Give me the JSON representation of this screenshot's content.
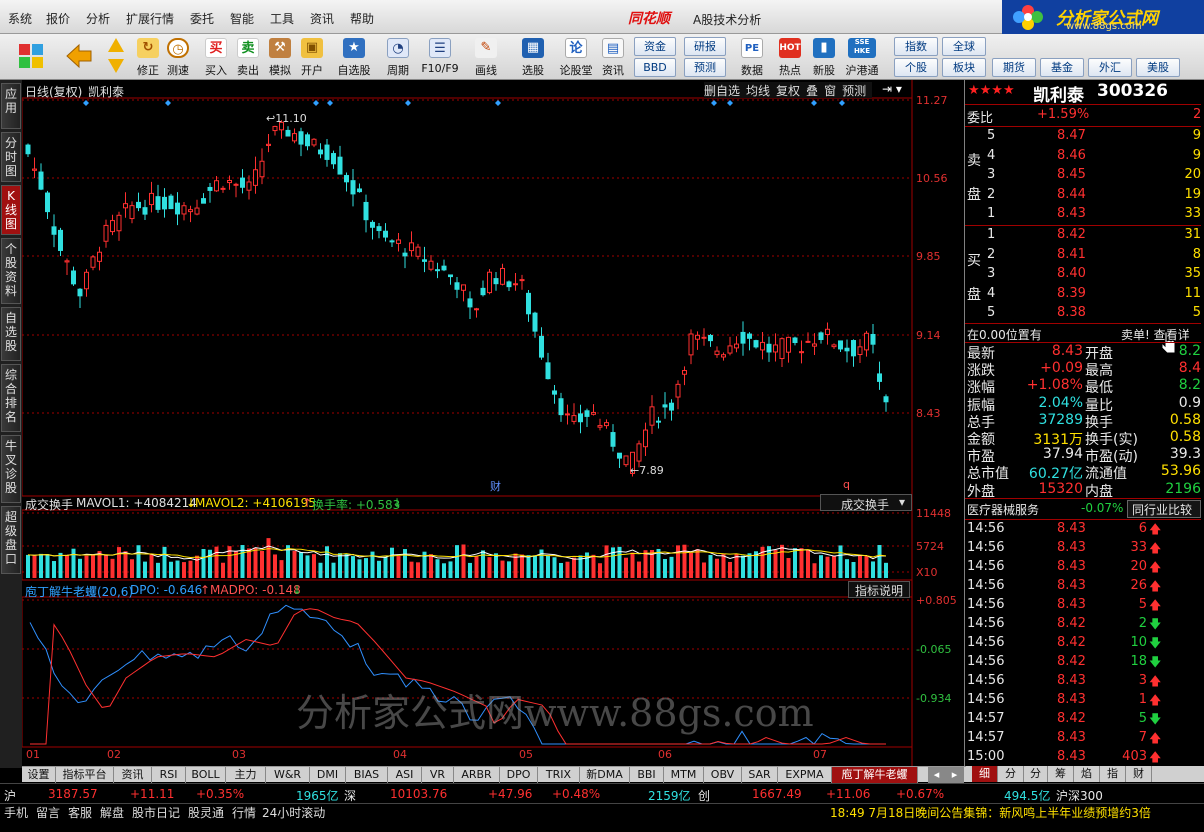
{
  "menu": [
    "系统",
    "报价",
    "分析",
    "扩展行情",
    "委托",
    "智能",
    "工具",
    "资讯",
    "帮助"
  ],
  "app": {
    "logo": "同花顺",
    "title": "A股技术分析"
  },
  "brand": {
    "name": "分析家公式网",
    "url": "www.88gs.com"
  },
  "toolbar": [
    "修正",
    "测速",
    "买入",
    "卖出",
    "模拟",
    "开户",
    "自选股",
    "周期",
    "F10/F9",
    "画线",
    "选股",
    "论股堂",
    "资讯",
    "数据",
    "热点",
    "新股",
    "沪港通"
  ],
  "toolbar_icons": {
    "buy": "买",
    "sell": "卖",
    "data": "PE",
    "hot": "HOT",
    "hk": "SSE HKE",
    "lun": "论"
  },
  "toolbar_btns": [
    "资金",
    "研报",
    "BBD",
    "预测",
    "指数",
    "全球",
    "个股",
    "板块",
    "期货",
    "基金",
    "外汇",
    "美股"
  ],
  "left_tabs": [
    "应用",
    "分时图",
    "K线图",
    "个股资料",
    "自选股",
    "综合排名",
    "牛叉诊股",
    "超级盘口"
  ],
  "main": {
    "title": "日线(复权)",
    "stock": "凯利泰",
    "ctrl": [
      "删自选",
      "均线",
      "复权",
      "叠",
      "窗",
      "预测"
    ],
    "prices": [
      "11.27",
      "10.56",
      "9.85",
      "9.14",
      "8.43"
    ],
    "high_label": "11.10",
    "low_label": "7.89",
    "markers": [
      "财",
      "q"
    ]
  },
  "vol": {
    "name": "成交换手",
    "mavol1": "MAVOL1: +4084214",
    "mavol2": "MAVOL2: +4106195",
    "turnover": "换手率: +0.583",
    "dropdown": "成交换手",
    "axis": [
      "11448",
      "5724",
      "X10"
    ]
  },
  "ind": {
    "name": "庖丁解牛老蠼(20,6)",
    "dpo": "DPO: -0.646",
    "madpo": "MADPO: -0.148",
    "btn": "指标说明",
    "axis": [
      "+0.805",
      "-0.065",
      "-0.934"
    ]
  },
  "watermark": "分析家公式网www.88gs.com",
  "months": [
    "01",
    "02",
    "03",
    "04",
    "05",
    "06",
    "07"
  ],
  "bottom_tabs": [
    "设置",
    "指标平台",
    "资讯",
    "RSI",
    "BOLL",
    "主力",
    "W&R",
    "DMI",
    "BIAS",
    "ASI",
    "VR",
    "ARBR",
    "DPO",
    "TRIX",
    "新DMA",
    "BBI",
    "MTM",
    "OBV",
    "SAR",
    "EXPMA",
    "庖丁解牛老蠼"
  ],
  "right": {
    "stars": "★★★★",
    "name": "凯利泰",
    "code": "300326",
    "weibi_label": "委比",
    "weibi": "+1.59%",
    "weibi_r": "2",
    "sell_label": [
      "卖",
      "盘"
    ],
    "buy_label": [
      "买",
      "盘"
    ],
    "sell": [
      {
        "n": "5",
        "p": "8.47",
        "v": "9"
      },
      {
        "n": "4",
        "p": "8.46",
        "v": "9"
      },
      {
        "n": "3",
        "p": "8.45",
        "v": "20"
      },
      {
        "n": "2",
        "p": "8.44",
        "v": "19"
      },
      {
        "n": "1",
        "p": "8.43",
        "v": "33"
      }
    ],
    "buy": [
      {
        "n": "1",
        "p": "8.42",
        "v": "31"
      },
      {
        "n": "2",
        "p": "8.41",
        "v": "8"
      },
      {
        "n": "3",
        "p": "8.40",
        "v": "35"
      },
      {
        "n": "4",
        "p": "8.39",
        "v": "11"
      },
      {
        "n": "5",
        "p": "8.38",
        "v": "5"
      }
    ],
    "info_left": "在0.00位置有",
    "info_right": "卖单! 查看详",
    "quote": [
      {
        "l": "最新",
        "v": "8.43",
        "l2": "开盘",
        "v2": "8.2"
      },
      {
        "l": "涨跌",
        "v": "+0.09",
        "l2": "最高",
        "v2": "8.4"
      },
      {
        "l": "涨幅",
        "v": "+1.08%",
        "l2": "最低",
        "v2": "8.2"
      },
      {
        "l": "振幅",
        "v": "2.04%",
        "l2": "量比",
        "v2": "0.9"
      },
      {
        "l": "总手",
        "v": "37289",
        "l2": "换手",
        "v2": "0.58"
      },
      {
        "l": "金额",
        "v": "3131万",
        "l2": "换手(实)",
        "v2": "0.58"
      },
      {
        "l": "市盈",
        "v": "37.94",
        "l2": "市盈(动)",
        "v2": "39.3"
      },
      {
        "l": "总市值",
        "v": "60.27亿",
        "l2": "流通值",
        "v2": "53.96"
      },
      {
        "l": "外盘",
        "v": "15320",
        "l2": "内盘",
        "v2": "2196"
      }
    ],
    "sector": "医疗器械服务",
    "sector_chg": "-0.07%",
    "sector_btn": "同行业比较",
    "ticks": [
      {
        "t": "14:56",
        "p": "8.43",
        "v": "6",
        "d": "up"
      },
      {
        "t": "14:56",
        "p": "8.43",
        "v": "33",
        "d": "up"
      },
      {
        "t": "14:56",
        "p": "8.43",
        "v": "20",
        "d": "up"
      },
      {
        "t": "14:56",
        "p": "8.43",
        "v": "26",
        "d": "up"
      },
      {
        "t": "14:56",
        "p": "8.43",
        "v": "5",
        "d": "up"
      },
      {
        "t": "14:56",
        "p": "8.42",
        "v": "2",
        "d": "dn"
      },
      {
        "t": "14:56",
        "p": "8.42",
        "v": "10",
        "d": "dn"
      },
      {
        "t": "14:56",
        "p": "8.42",
        "v": "18",
        "d": "dn"
      },
      {
        "t": "14:56",
        "p": "8.43",
        "v": "3",
        "d": "up"
      },
      {
        "t": "14:56",
        "p": "8.43",
        "v": "1",
        "d": "up"
      },
      {
        "t": "14:57",
        "p": "8.42",
        "v": "5",
        "d": "dn"
      },
      {
        "t": "14:57",
        "p": "8.43",
        "v": "7",
        "d": "up"
      },
      {
        "t": "15:00",
        "p": "8.43",
        "v": "403",
        "d": "up"
      }
    ],
    "tabs": [
      "细",
      "分",
      "分",
      "筹",
      "焰",
      "指",
      "财"
    ]
  },
  "status": {
    "sh": "沪",
    "sh_idx": "3187.57",
    "sh_chg": "+11.11",
    "sh_pct": "+0.35%",
    "sh_amt": "1965亿",
    "sz": "深",
    "sz_idx": "10103.76",
    "sz_chg": "+47.96",
    "sz_pct": "+0.48%",
    "sz_amt": "2159亿",
    "cy": "创",
    "cy_idx": "1667.49",
    "cy_chg": "+11.06",
    "cy_pct": "+0.67%",
    "hs_amt": "494.5亿",
    "hs": "沪深300"
  },
  "footer": {
    "items": [
      "手机",
      "留言",
      "客服",
      "解盘",
      "股市日记",
      "股灵通",
      "行情",
      "24小时滚动"
    ],
    "news": "18:49 7月18日晚间公告集锦：新风鸣上半年业绩预增约3倍"
  }
}
